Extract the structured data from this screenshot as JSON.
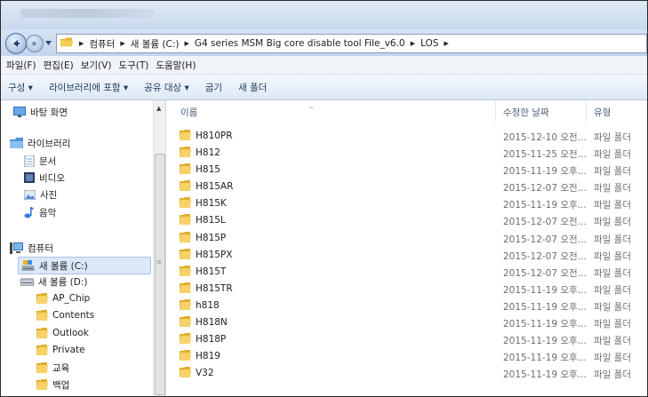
{
  "window": {
    "address": {
      "crumbs": [
        "컴퓨터",
        "새 볼륨 (C:)",
        "G4 series MSM Big core disable tool File_v6.0",
        "LOS"
      ]
    }
  },
  "menubar": {
    "items": [
      "파일(F)",
      "편집(E)",
      "보기(V)",
      "도구(T)",
      "도움말(H)"
    ]
  },
  "toolbar": {
    "organize": "구성 ▾",
    "include_library": "라이브러리에 포함 ▾",
    "share": "공유 대상 ▾",
    "burn": "굽기",
    "new_folder": "새 폴더"
  },
  "navpane": {
    "items": [
      {
        "label": "바탕 화면",
        "icon": "desktop-icon"
      },
      {
        "label": "라이브러리",
        "icon": "library-icon"
      },
      {
        "label": "문서",
        "icon": "documents-icon"
      },
      {
        "label": "비디오",
        "icon": "video-icon"
      },
      {
        "label": "사진",
        "icon": "pictures-icon"
      },
      {
        "label": "음악",
        "icon": "music-icon"
      },
      {
        "label": "컴퓨터",
        "icon": "computer-icon"
      },
      {
        "label": "새 볼륨 (C:)",
        "icon": "drive-icon",
        "selected": true
      },
      {
        "label": "새 볼륨 (D:)",
        "icon": "drive-icon"
      },
      {
        "label": "AP_Chip",
        "icon": "folder-icon"
      },
      {
        "label": "Contents",
        "icon": "folder-icon"
      },
      {
        "label": "Outlook",
        "icon": "folder-icon"
      },
      {
        "label": "Private",
        "icon": "folder-icon"
      },
      {
        "label": "교육",
        "icon": "folder-icon"
      },
      {
        "label": "백업",
        "icon": "folder-icon"
      }
    ]
  },
  "columns": {
    "name": "이름",
    "date": "수정한 날짜",
    "type": "유형"
  },
  "files": [
    {
      "name": "H810PR",
      "date": "2015-12-10 오전...",
      "type": "파일 폴더"
    },
    {
      "name": "H812",
      "date": "2015-11-25 오전...",
      "type": "파일 폴더"
    },
    {
      "name": "H815",
      "date": "2015-11-19 오후...",
      "type": "파일 폴더"
    },
    {
      "name": "H815AR",
      "date": "2015-12-07 오전...",
      "type": "파일 폴더"
    },
    {
      "name": "H815K",
      "date": "2015-11-19 오후...",
      "type": "파일 폴더"
    },
    {
      "name": "H815L",
      "date": "2015-12-07 오전...",
      "type": "파일 폴더"
    },
    {
      "name": "H815P",
      "date": "2015-12-07 오전...",
      "type": "파일 폴더"
    },
    {
      "name": "H815PX",
      "date": "2015-12-07 오전...",
      "type": "파일 폴더"
    },
    {
      "name": "H815T",
      "date": "2015-12-07 오전...",
      "type": "파일 폴더"
    },
    {
      "name": "H815TR",
      "date": "2015-11-19 오후...",
      "type": "파일 폴더"
    },
    {
      "name": "h818",
      "date": "2015-11-19 오후...",
      "type": "파일 폴더"
    },
    {
      "name": "H818N",
      "date": "2015-11-19 오후...",
      "type": "파일 폴더"
    },
    {
      "name": "H818P",
      "date": "2015-11-19 오후...",
      "type": "파일 폴더"
    },
    {
      "name": "H819",
      "date": "2015-11-19 오후...",
      "type": "파일 폴더"
    },
    {
      "name": "V32",
      "date": "2015-11-19 오후...",
      "type": "파일 폴더"
    }
  ]
}
